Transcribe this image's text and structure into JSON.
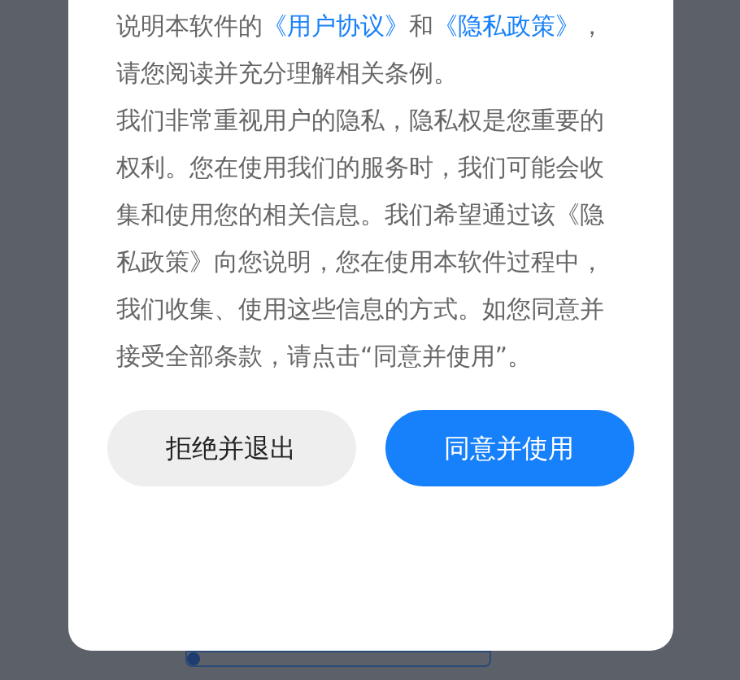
{
  "intro": [
    {
      "kind": "text",
      "text": "说明本软件的"
    },
    {
      "kind": "link",
      "text": "《用户协议》"
    },
    {
      "kind": "text",
      "text": "和"
    },
    {
      "kind": "link",
      "text": "《隐私政策》"
    },
    {
      "kind": "text",
      "text": "，请您阅读并充分理解相关条例。"
    }
  ],
  "body": "我们非常重视用户的隐私，隐私权是您重要的权利。您在使用我们的服务时，我们可能会收集和使用您的相关信息。我们希望通过该《隐私政策》向您说明，您在使用本软件过程中，我们收集、使用这些信息的方式。如您同意并接受全部条款，请点击“同意并使用”。",
  "buttons": [
    {
      "kind": "secondary",
      "label": "拒绝并退出"
    },
    {
      "kind": "primary",
      "label": "同意并使用"
    }
  ]
}
